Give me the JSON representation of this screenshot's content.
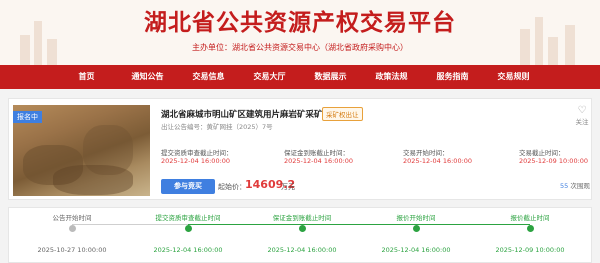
{
  "header": {
    "title": "湖北省公共资源产权交易平台",
    "sponsor_label": "主办单位：",
    "sponsor": "湖北省公共资源交易中心（湖北省政府采购中心）"
  },
  "nav": {
    "items": [
      "首页",
      "通知公告",
      "交易信息",
      "交易大厅",
      "数据展示",
      "政策法规",
      "服务指南",
      "交易规则"
    ]
  },
  "project": {
    "badge": "报名中",
    "title": "湖北省麻城市明山矿区建筑用片麻岩矿采矿权",
    "tag": "采矿权出让",
    "number": "出让公告编号：黄矿网挂（2025）7号",
    "follow_label": "关注",
    "deadlines": [
      {
        "label": "提交资质审查截止时间：",
        "value": "2025-12-04 16:00:00"
      },
      {
        "label": "保证金到账截止时间：",
        "value": "2025-12-04 16:00:00"
      },
      {
        "label": "交易开始时间：",
        "value": "2025-12-04 16:00:00"
      },
      {
        "label": "交易截止时间：",
        "value": "2025-12-09 10:00:00"
      }
    ],
    "join_button": "参与竞买",
    "price_label": "起始价：",
    "price_value": "14609.2",
    "price_unit": "万元",
    "views_count": "55",
    "views_label": "次围观"
  },
  "timeline": {
    "steps": [
      {
        "label": "公告开始时间",
        "date": "2025-10-27 10:00:00",
        "state": "done"
      },
      {
        "label": "提交资质审查截止时间",
        "date": "2025-12-04 16:00:00",
        "state": "active"
      },
      {
        "label": "保证金到账截止时间",
        "date": "2025-12-04 16:00:00",
        "state": "active"
      },
      {
        "label": "报价开始时间",
        "date": "2025-12-04 16:00:00",
        "state": "active"
      },
      {
        "label": "报价截止时间",
        "date": "2025-12-09 10:00:00",
        "state": "active"
      }
    ],
    "colors": {
      "done": "#999999",
      "active": "#2ca341"
    }
  }
}
